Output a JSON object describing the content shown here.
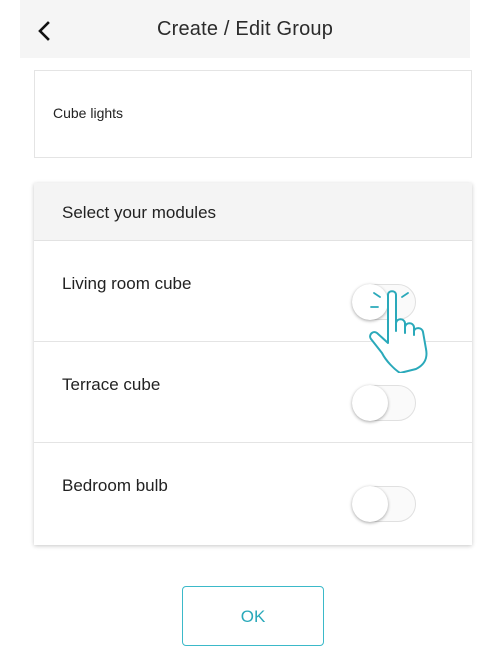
{
  "header": {
    "title": "Create / Edit Group"
  },
  "group_name": {
    "value": "Cube lights"
  },
  "modules": {
    "title": "Select your modules",
    "items": [
      {
        "label": "Living room cube",
        "enabled": false
      },
      {
        "label": "Terrace cube",
        "enabled": false
      },
      {
        "label": "Bedroom bulb",
        "enabled": false
      }
    ]
  },
  "ok_button": {
    "label": "OK"
  },
  "colors": {
    "accent": "#3bb9c9",
    "hand_outline": "#2aa9ba"
  },
  "icons": {
    "back": "chevron-left-icon",
    "pointer": "tap-hand-icon"
  }
}
